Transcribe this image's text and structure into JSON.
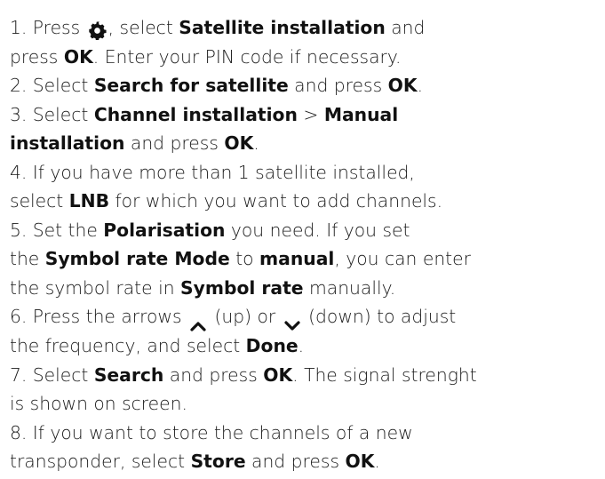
{
  "icons": {
    "settings": "gear-icon",
    "up": "chevron-up-icon",
    "down": "chevron-down-icon"
  },
  "steps": {
    "s1": {
      "a": "1. Press ",
      "b": ", select ",
      "c": "Satellite installation",
      "d": " and"
    },
    "s1b": {
      "a": "press ",
      "b": "OK",
      "c": ". Enter your PIN code if necessary."
    },
    "s2": {
      "a": "2. Select ",
      "b": "Search for satellite",
      "c": " and press ",
      "d": "OK",
      "e": "."
    },
    "s3": {
      "a": "3. Select ",
      "b": "Channel installation",
      "c": " > ",
      "d": "Manual"
    },
    "s3b": {
      "a": "installation",
      "b": " and press ",
      "c": "OK",
      "d": "."
    },
    "s4": {
      "a": "4. If you have more than 1 satellite installed,"
    },
    "s4b": {
      "a": "select ",
      "b": "LNB",
      "c": " for which you want to add channels."
    },
    "s5": {
      "a": "5. Set the ",
      "b": "Polarisation",
      "c": " you need. If you set"
    },
    "s5b": {
      "a": "the ",
      "b": "Symbol rate Mode",
      "c": " to ",
      "d": "manual",
      "e": ", you can enter"
    },
    "s5c": {
      "a": "the symbol rate in ",
      "b": "Symbol rate",
      "c": " manually."
    },
    "s6": {
      "a": "6. Press the arrows ",
      "b": " (up) or ",
      "c": " (down) to adjust"
    },
    "s6b": {
      "a": "the frequency, and select ",
      "b": "Done",
      "c": "."
    },
    "s7": {
      "a": "7. Select ",
      "b": "Search",
      "c": " and press ",
      "d": "OK",
      "e": ". The signal strenght"
    },
    "s7b": {
      "a": "is shown on screen."
    },
    "s8": {
      "a": "8. If you want to store the channels of a new"
    },
    "s8b": {
      "a": "transponder, select ",
      "b": "Store",
      "c": " and press ",
      "d": "OK",
      "e": "."
    }
  }
}
